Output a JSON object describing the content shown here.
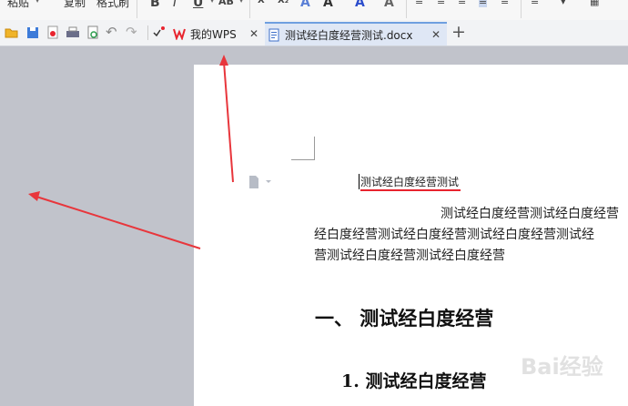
{
  "ribbon": {
    "paste_label": "粘贴",
    "copy_label": "复制",
    "format_painter_label": "格式刷"
  },
  "tabs": [
    {
      "label": "我的WPS",
      "icon": "wps-logo-icon",
      "active": false
    },
    {
      "label": "测试经白度经营测试.docx",
      "icon": "docx-icon",
      "active": true
    }
  ],
  "document": {
    "title_line": "测试经白度经营测试",
    "body_lines": [
      "测试经白度经营测试经白度经营",
      "经白度经营测试经白度经营测试经白度经营测试经",
      "营测试经白度经营测试经白度经营"
    ],
    "heading1": "一、 测试经白度经营",
    "heading2": "1. 测试经白度经营"
  },
  "watermark_text": "Bai经验",
  "colors": {
    "accent": "#e8242e",
    "active_tab": "#dfe7f5",
    "workspace": "#c1c3cb"
  }
}
